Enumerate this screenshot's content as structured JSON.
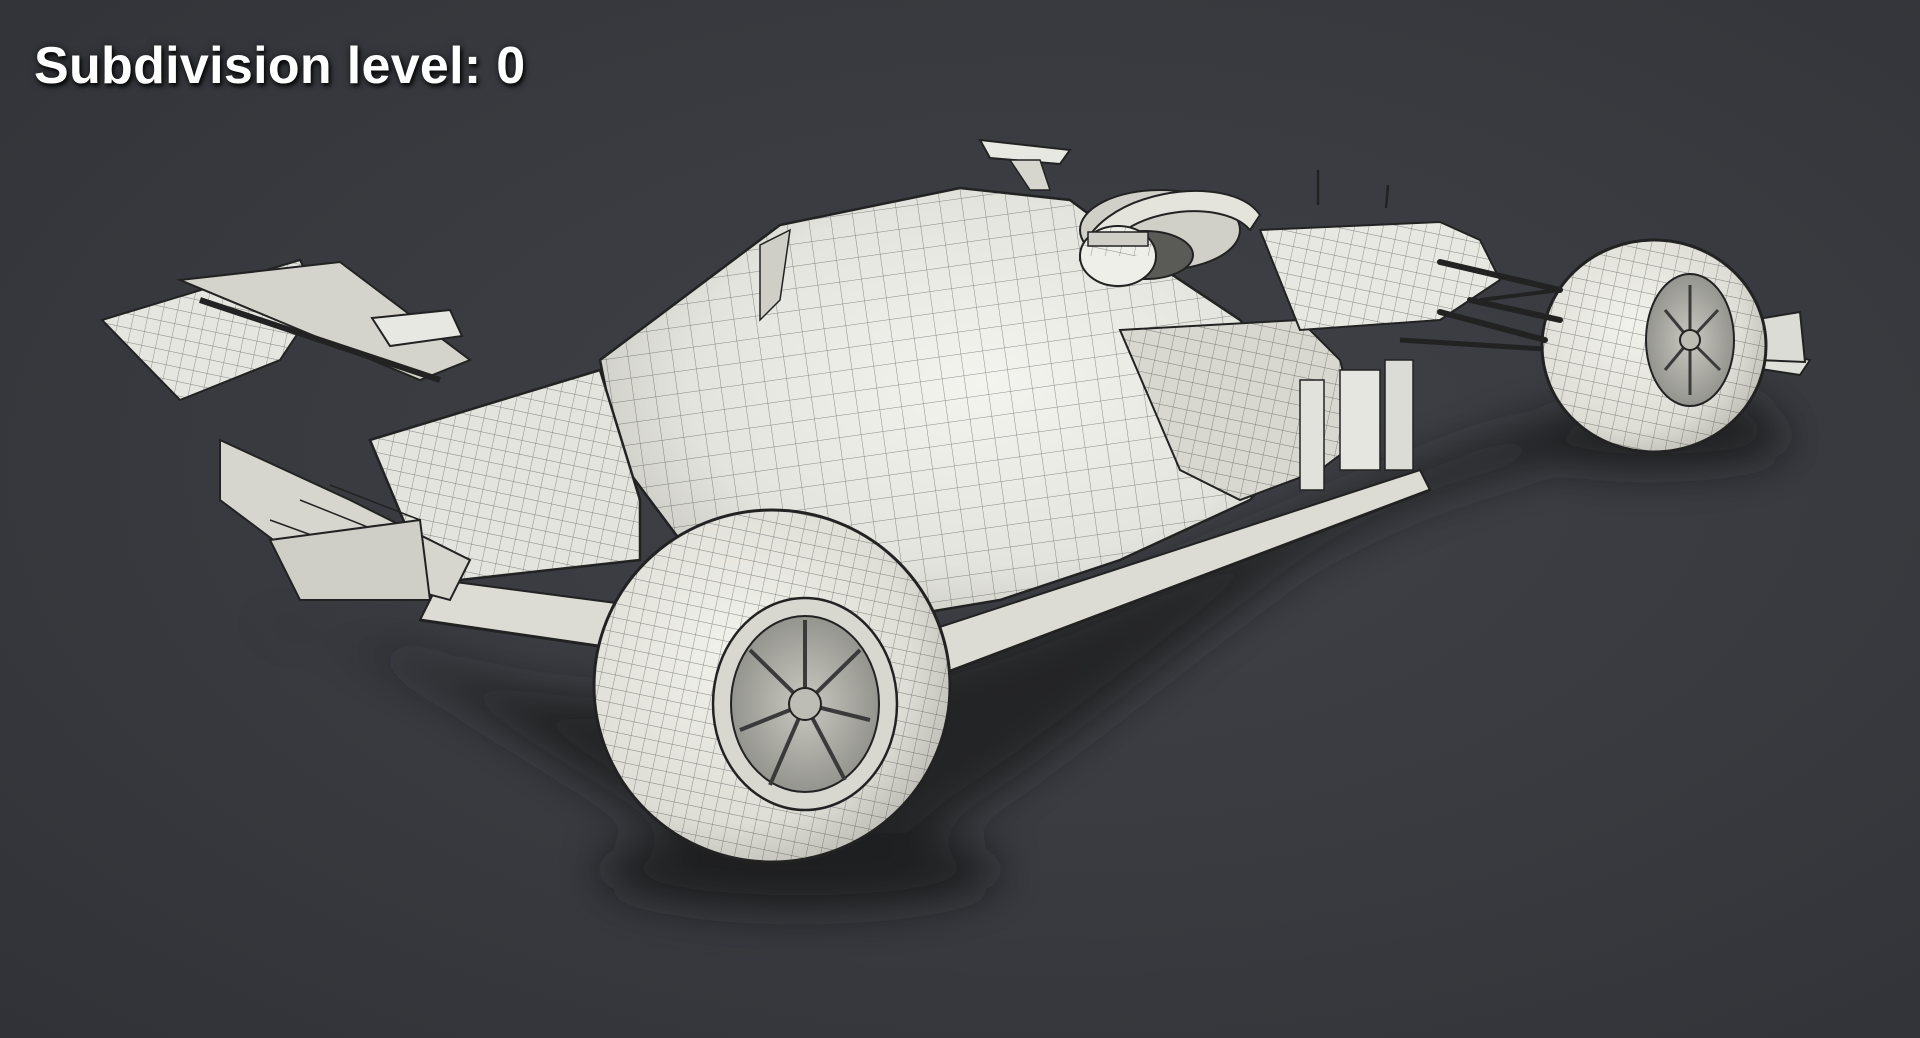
{
  "overlay": {
    "label": "Subdivision level: 0"
  },
  "scene": {
    "background_color": "#3a3c41",
    "model_surface_color": "#e8e8e2",
    "wireframe_color": "#2a2a2a",
    "shadow_color": "#1c1d20"
  }
}
